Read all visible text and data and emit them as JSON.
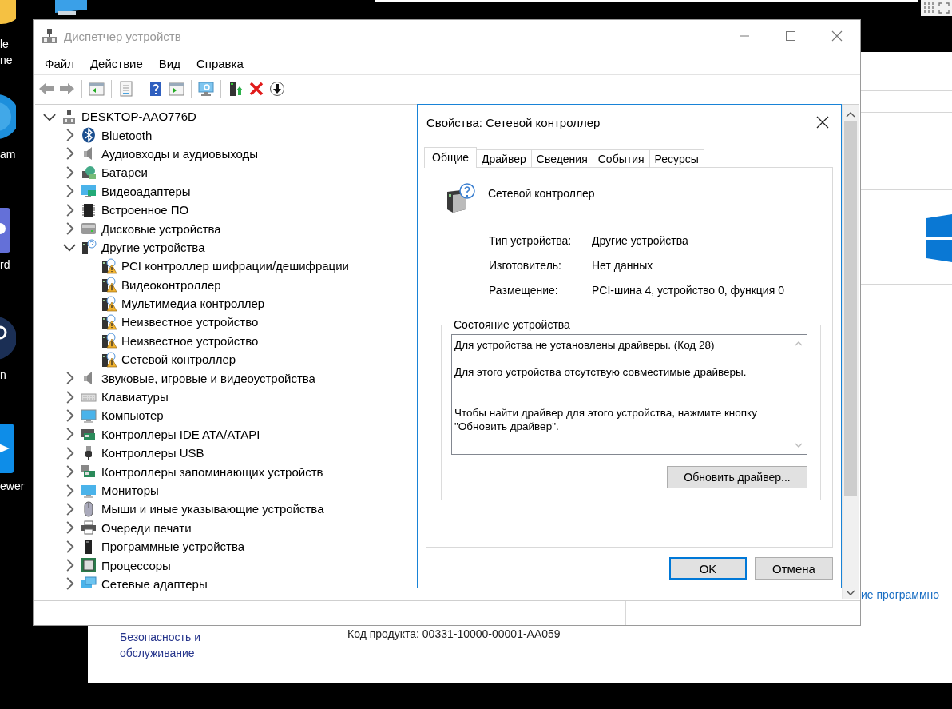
{
  "desktop": {
    "icons": [
      {
        "label": "le\nne"
      },
      {
        "label": "am"
      },
      {
        "label": "rd"
      },
      {
        "label": "n"
      },
      {
        "label": "ewer"
      }
    ]
  },
  "background_window": {
    "side_link": "ие программно",
    "security_link": "Безопасность и обслуживание",
    "product_code": "Код продукта: 00331-10000-00001-AA059"
  },
  "device_manager": {
    "title": "Диспетчер устройств",
    "menu": [
      "Файл",
      "Действие",
      "Вид",
      "Справка"
    ],
    "tree": {
      "label": "DESKTOP-AAO776D",
      "expanded": true,
      "children": [
        {
          "label": "Bluetooth",
          "expanded": false
        },
        {
          "label": "Аудиовходы и аудиовыходы",
          "expanded": false
        },
        {
          "label": "Батареи",
          "expanded": false
        },
        {
          "label": "Видеоадаптеры",
          "expanded": false
        },
        {
          "label": "Встроенное ПО",
          "expanded": false
        },
        {
          "label": "Дисковые устройства",
          "expanded": false
        },
        {
          "label": "Другие устройства",
          "expanded": true,
          "children": [
            {
              "label": "PCI контроллер шифрации/дешифрации",
              "warning": true
            },
            {
              "label": "Видеоконтроллер",
              "warning": true
            },
            {
              "label": "Мультимедиа контроллер",
              "warning": true
            },
            {
              "label": "Неизвестное устройство",
              "warning": true
            },
            {
              "label": "Неизвестное устройство",
              "warning": true
            },
            {
              "label": "Сетевой контроллер",
              "warning": true
            }
          ]
        },
        {
          "label": "Звуковые, игровые и видеоустройства",
          "expanded": false
        },
        {
          "label": "Клавиатуры",
          "expanded": false
        },
        {
          "label": "Компьютер",
          "expanded": false
        },
        {
          "label": "Контроллеры IDE ATA/ATAPI",
          "expanded": false
        },
        {
          "label": "Контроллеры USB",
          "expanded": false
        },
        {
          "label": "Контроллеры запоминающих устройств",
          "expanded": false
        },
        {
          "label": "Мониторы",
          "expanded": false
        },
        {
          "label": "Мыши и иные указывающие устройства",
          "expanded": false
        },
        {
          "label": "Очереди печати",
          "expanded": false
        },
        {
          "label": "Программные устройства",
          "expanded": false
        },
        {
          "label": "Процессоры",
          "expanded": false
        },
        {
          "label": "Сетевые адаптеры",
          "expanded": false
        }
      ]
    }
  },
  "properties_dialog": {
    "title": "Свойства: Сетевой контроллер",
    "tabs": [
      {
        "label": "Общие",
        "selected": true
      },
      {
        "label": "Драйвер",
        "selected": false
      },
      {
        "label": "Сведения",
        "selected": false
      },
      {
        "label": "События",
        "selected": false
      },
      {
        "label": "Ресурсы",
        "selected": false
      }
    ],
    "device_name": "Сетевой контроллер",
    "fields": [
      {
        "label": "Тип устройства:",
        "value": "Другие устройства"
      },
      {
        "label": "Изготовитель:",
        "value": "Нет данных"
      },
      {
        "label": "Размещение:",
        "value": "PCI-шина 4, устройство 0, функция 0"
      }
    ],
    "status": {
      "title": "Состояние устройства",
      "paragraphs": [
        "Для устройства не установлены драйверы. (Код 28)",
        "Для этого устройства отсутствую совместимые драйверы.",
        "Чтобы найти драйвер для этого устройства, нажмите кнопку \"Обновить драйвер\"."
      ]
    },
    "update_button": "Обновить драйвер...",
    "buttons": [
      {
        "label": "OK",
        "default": true
      },
      {
        "label": "Отмена",
        "default": false
      }
    ]
  }
}
